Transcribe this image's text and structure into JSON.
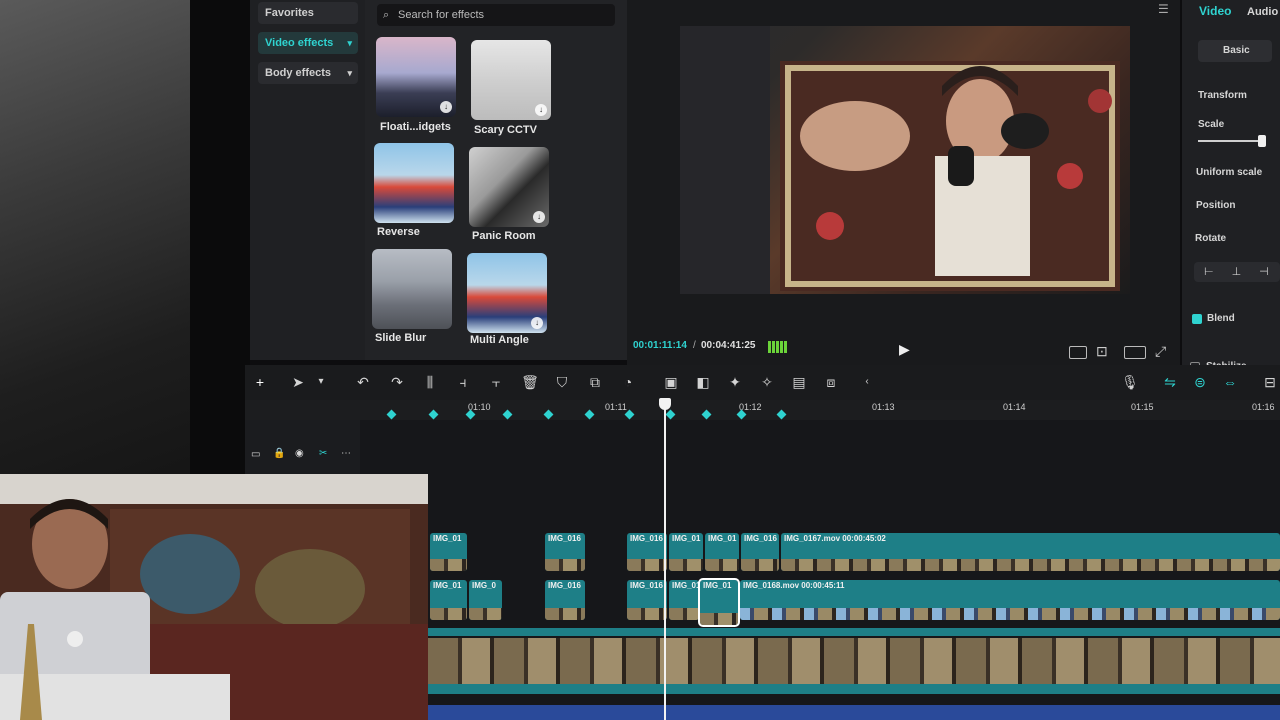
{
  "effects_nav": {
    "favorites": "Favorites",
    "video_effects": "Video effects",
    "body_effects": "Body effects"
  },
  "search": {
    "placeholder": "Search for effects"
  },
  "effects": [
    {
      "label": "Floati...idgets"
    },
    {
      "label": "Scary CCTV"
    },
    {
      "label": "Reverse"
    },
    {
      "label": "Panic Room"
    },
    {
      "label": "Slide Blur"
    },
    {
      "label": "Multi Angle"
    }
  ],
  "player": {
    "time_current": "00:01:11:14",
    "time_separator": "/",
    "time_total": "00:04:41:25"
  },
  "right_panel": {
    "tab_video": "Video",
    "tab_audio": "Audio",
    "basic": "Basic",
    "transform": "Transform",
    "scale": "Scale",
    "uniform_scale": "Uniform scale",
    "position": "Position",
    "rotate": "Rotate",
    "blend": "Blend",
    "stabilize": "Stabilize"
  },
  "ruler": {
    "ticks": [
      "01:10",
      "01:11",
      "01:12",
      "01:13",
      "01:14",
      "01:15",
      "01:16"
    ]
  },
  "timeline": {
    "track1": [
      "IMG_01",
      "IMG_016",
      "IMG_016",
      "IMG_01",
      "IMG_01",
      "IMG_016",
      "IMG_0167.mov  00:00:45:02"
    ],
    "track2": [
      "IMG_01",
      "IMG_0",
      "IMG_016",
      "IMG_016",
      "IMG_01",
      "IMG_01",
      "IMG_0168.mov  00:00:45:11"
    ]
  },
  "colors": {
    "accent": "#2fd3d0",
    "clip": "#1e7f87"
  }
}
